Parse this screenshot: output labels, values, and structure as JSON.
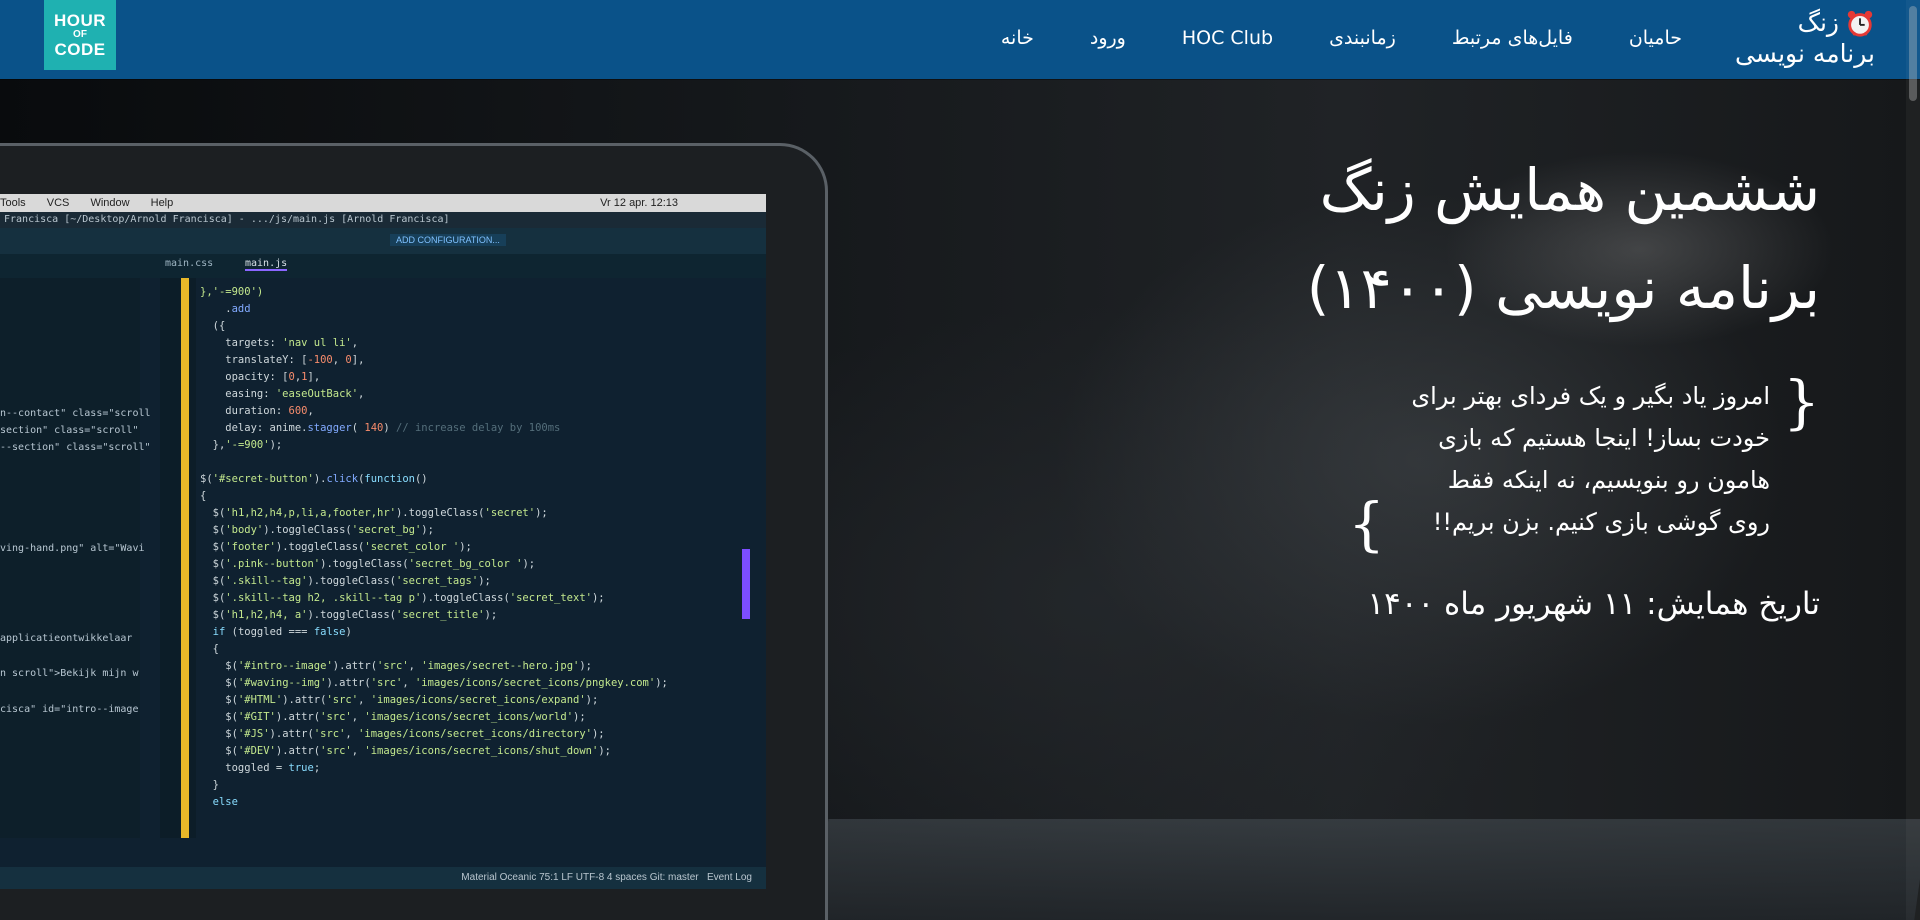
{
  "navbar": {
    "logo": {
      "line1": "HOUR",
      "line2": "OF",
      "line3": "CODE"
    },
    "brand": {
      "line1": "زنگ",
      "line2": "برنامه نویسی",
      "icon": "alarm-clock-icon"
    },
    "links": [
      {
        "label": "خانه"
      },
      {
        "label": "ورود"
      },
      {
        "label": "HOC Club"
      },
      {
        "label": "زمانبندی"
      },
      {
        "label": "فایل‌های مرتبط"
      },
      {
        "label": "حامیان"
      }
    ],
    "background": "#0a5289"
  },
  "hero": {
    "title_line1": "ششمین همایش زنگ",
    "title_line2": "برنامه نویسی (۱۴۰۰)",
    "quote_open": "{",
    "quote_close": "}",
    "quote_lines": [
      "امروز یاد بگیر و یک فردای بهتر برای",
      "خودت بساز! اینجا هستیم که بازی",
      "هامون رو بنویسیم، نه اینکه فقط",
      "روی گوشی بازی کنیم. بزن بریم!!"
    ],
    "date": "تاریخ همایش: ۱۱ شهریور ماه ۱۴۰۰"
  },
  "laptop_screen": {
    "menubar": [
      "Tools",
      "VCS",
      "Window",
      "Help"
    ],
    "clock": "Vr 12 apr. 12:13",
    "window_title": "Francisca [~/Desktop/Arnold Francisca] - .../js/main.js [Arnold Francisca]",
    "config_button": "ADD CONFIGURATION...",
    "tabs": [
      "main.css",
      "main.js"
    ],
    "status": "Material Oceanic   75:1   LF   UTF-8   4 spaces   Git: master",
    "event_log": "Event Log"
  },
  "colors": {
    "accent_logo": "#1fb1b1",
    "text": "#ffffff"
  }
}
